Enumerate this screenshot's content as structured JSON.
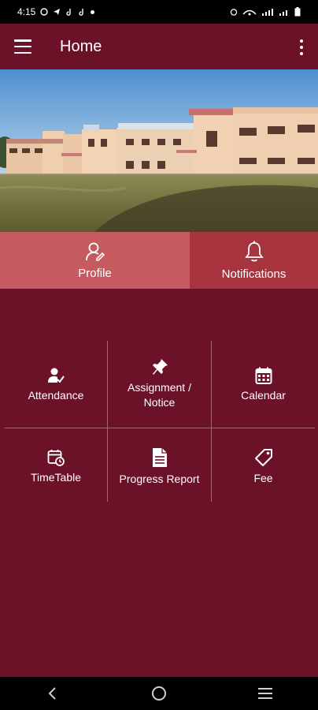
{
  "status_bar": {
    "time": "4:15"
  },
  "app_bar": {
    "title": "Home"
  },
  "tabs": [
    {
      "label": "Profile",
      "icon": "profile-icon"
    },
    {
      "label": "Notifications",
      "icon": "bell-icon"
    }
  ],
  "menu_items": [
    {
      "label": "Attendance",
      "icon": "attendance-icon"
    },
    {
      "label": "Assignment / Notice",
      "icon": "pin-icon"
    },
    {
      "label": "Calendar",
      "icon": "calendar-icon"
    },
    {
      "label": "TimeTable",
      "icon": "timetable-icon"
    },
    {
      "label": "Progress Report",
      "icon": "document-icon"
    },
    {
      "label": "Fee",
      "icon": "tag-icon"
    }
  ],
  "colors": {
    "primary": "#6b1128",
    "profile_tab": "#c65a61",
    "notifications_tab": "#a8343f"
  }
}
